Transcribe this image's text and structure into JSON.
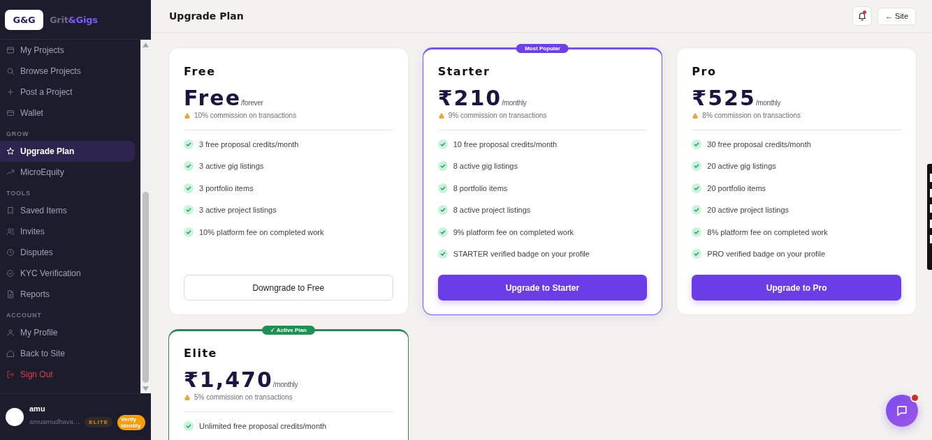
{
  "sidebar": {
    "logo_mark": "G&G",
    "brand": [
      {
        "text": "Grit",
        "color": "#6b6983"
      },
      {
        "text": "&Gigs",
        "color": "#7b5cf0"
      }
    ],
    "nav": [
      {
        "items": [
          {
            "label": "My Projects",
            "kind": "link",
            "selected": false
          },
          {
            "label": "Browse Projects",
            "kind": "link",
            "selected": false
          },
          {
            "label": "Post a Project",
            "kind": "link",
            "selected": false
          },
          {
            "label": "Wallet",
            "kind": "link",
            "selected": false
          }
        ]
      },
      {
        "heading": "GROW",
        "items": [
          {
            "label": "Upgrade Plan",
            "kind": "link",
            "selected": true
          },
          {
            "label": "MicroEquity",
            "kind": "link",
            "selected": false
          }
        ]
      },
      {
        "heading": "TOOLS",
        "items": [
          {
            "label": "Saved Items",
            "kind": "link",
            "selected": false
          },
          {
            "label": "Invites",
            "kind": "link",
            "selected": false
          },
          {
            "label": "Disputes",
            "kind": "link",
            "selected": false
          },
          {
            "label": "KYC Verification",
            "kind": "link",
            "selected": false
          },
          {
            "label": "Reports",
            "kind": "link",
            "selected": false
          }
        ]
      },
      {
        "heading": "ACCOUNT",
        "items": [
          {
            "label": "My Profile",
            "kind": "link",
            "selected": false
          },
          {
            "label": "Back to Site",
            "kind": "link",
            "selected": false
          },
          {
            "label": "Sign Out",
            "kind": "danger",
            "selected": false
          }
        ]
      }
    ],
    "user": {
      "name": "amu",
      "handle": "amuamudhava…",
      "tier": "ELITE",
      "verify_label": "Verify Identity"
    }
  },
  "header": {
    "title": "Upgrade Plan",
    "notifications": {
      "has_unread": true
    },
    "back_link": "← Site"
  },
  "plans": [
    {
      "name": "Free",
      "price": "Free",
      "period": "/forever",
      "commission": "10% commission on transactions",
      "features": [
        "3 free proposal credits/month",
        "3 active gig listings",
        "3 portfolio items",
        "3 active project listings",
        "10% platform fee on completed work"
      ],
      "button": {
        "label": "Downgrade to Free",
        "kind": "outline"
      }
    },
    {
      "name": "Starter",
      "badge": {
        "label": "Most Popular",
        "kind": "popular"
      },
      "price": "₹210",
      "period": "/monthly",
      "commission": "9% commission on transactions",
      "features": [
        "10 free proposal credits/month",
        "8 active gig listings",
        "8 portfolio items",
        "8 active project listings",
        "9% platform fee on completed work",
        "STARTER verified badge on your profile"
      ],
      "button": {
        "label": "Upgrade to Starter",
        "kind": "primary"
      }
    },
    {
      "name": "Pro",
      "price": "₹525",
      "period": "/monthly",
      "commission": "8% commission on transactions",
      "features": [
        "30 free proposal credits/month",
        "20 active gig listings",
        "20 portfolio items",
        "20 active project listings",
        "8% platform fee on completed work",
        "PRO verified badge on your profile"
      ],
      "button": {
        "label": "Upgrade to Pro",
        "kind": "primary"
      }
    },
    {
      "name": "Elite",
      "badge": {
        "label": "✓ Active Plan",
        "kind": "current"
      },
      "price": "₹1,470",
      "period": "/monthly",
      "commission": "5% commission on transactions",
      "features": [
        "Unlimited free proposal credits/month"
      ]
    }
  ],
  "chat_button": {
    "has_unread": true
  }
}
